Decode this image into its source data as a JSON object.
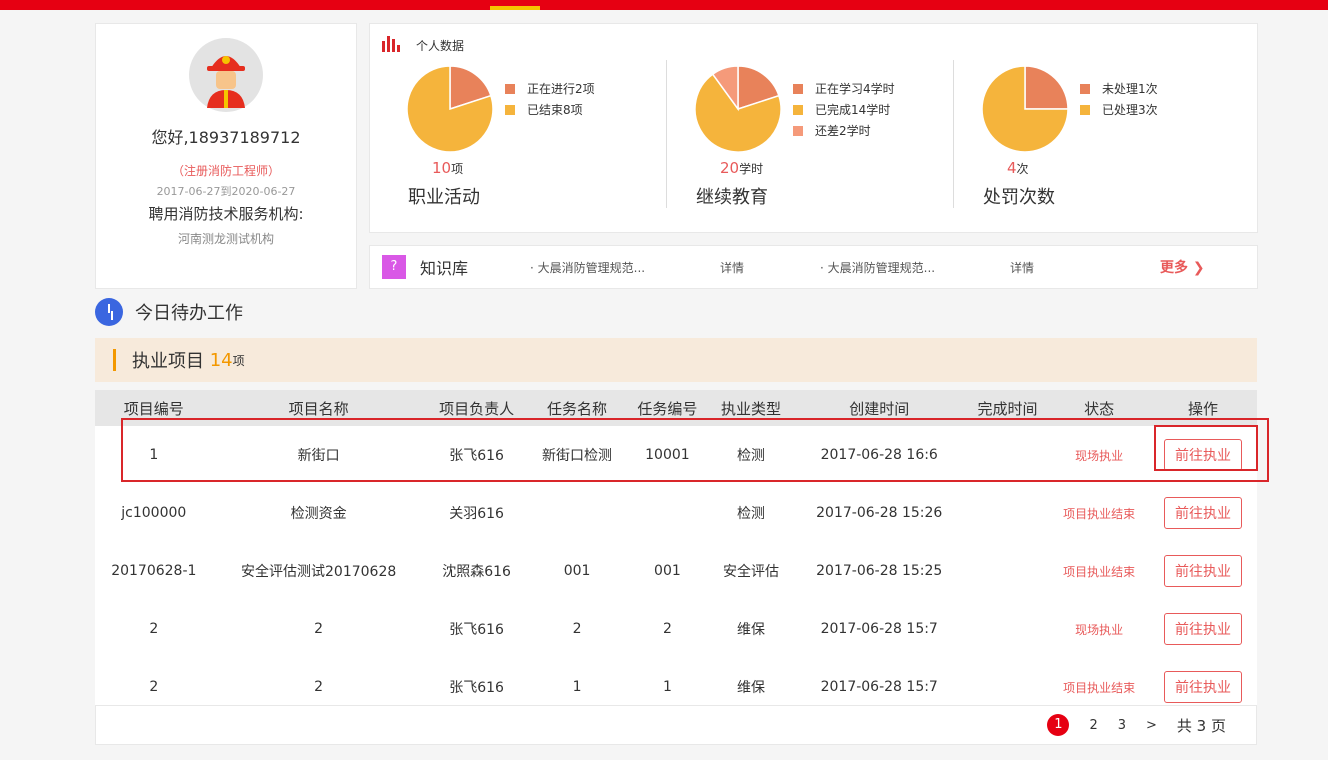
{
  "profile": {
    "greeting": "您好,18937189712",
    "cert": "（注册消防工程师）",
    "valid": "2017-06-27到2020-06-27",
    "org_label": "聘用消防技术服务机构:",
    "org": "河南测龙测试机构"
  },
  "stats": {
    "title": "个人数据"
  },
  "chart_data": [
    {
      "type": "pie",
      "title": "职业活动",
      "total": "10",
      "unit": "项",
      "slices": [
        {
          "name": "正在进行2项",
          "value": 2,
          "color": "#e8825a"
        },
        {
          "name": "已结束8项",
          "value": 8,
          "color": "#f5b43c"
        }
      ]
    },
    {
      "type": "pie",
      "title": "继续教育",
      "total": "20",
      "unit": "学时",
      "slices": [
        {
          "name": "正在学习4学时",
          "value": 4,
          "color": "#e8825a"
        },
        {
          "name": "已完成14学时",
          "value": 14,
          "color": "#f5b43c"
        },
        {
          "name": "还差2学时",
          "value": 2,
          "color": "#f59a7a"
        }
      ]
    },
    {
      "type": "pie",
      "title": "处罚次数",
      "total": "4",
      "unit": "次",
      "slices": [
        {
          "name": "未处理1次",
          "value": 1,
          "color": "#e8825a"
        },
        {
          "name": "已处理3次",
          "value": 3,
          "color": "#f5b43c"
        }
      ]
    }
  ],
  "kb": {
    "title": "知识库",
    "items": [
      "· 大晨消防管理规范...",
      "详情",
      "· 大晨消防管理规范...",
      "详情"
    ],
    "more": "更多 ❯"
  },
  "todo": {
    "title": "今日待办工作"
  },
  "project": {
    "title": "执业项目",
    "count": "14",
    "unit": "项"
  },
  "table": {
    "headers": [
      "项目编号",
      "项目名称",
      "项目负责人",
      "任务名称",
      "任务编号",
      "执业类型",
      "创建时间",
      "完成时间",
      "状态",
      "操作"
    ],
    "rows": [
      [
        "1",
        "新街口",
        "张飞616",
        "新街口检测",
        "10001",
        "检测",
        "2017-06-28 16:6",
        "",
        "现场执业",
        "前往执业"
      ],
      [
        "jc100000",
        "检测资金",
        "关羽616",
        "",
        "",
        "检测",
        "2017-06-28 15:26",
        "",
        "项目执业结束",
        "前往执业"
      ],
      [
        "20170628-1",
        "安全评估测试20170628",
        "沈照森616",
        "001",
        "001",
        "安全评估",
        "2017-06-28 15:25",
        "",
        "项目执业结束",
        "前往执业"
      ],
      [
        "2",
        "2",
        "张飞616",
        "2",
        "2",
        "维保",
        "2017-06-28 15:7",
        "",
        "现场执业",
        "前往执业"
      ],
      [
        "2",
        "2",
        "张飞616",
        "1",
        "1",
        "维保",
        "2017-06-28 15:7",
        "",
        "项目执业结束",
        "前往执业"
      ]
    ]
  },
  "pager": {
    "pages": [
      "1",
      "2",
      "3"
    ],
    "next": ">",
    "total": "共 3 页"
  }
}
